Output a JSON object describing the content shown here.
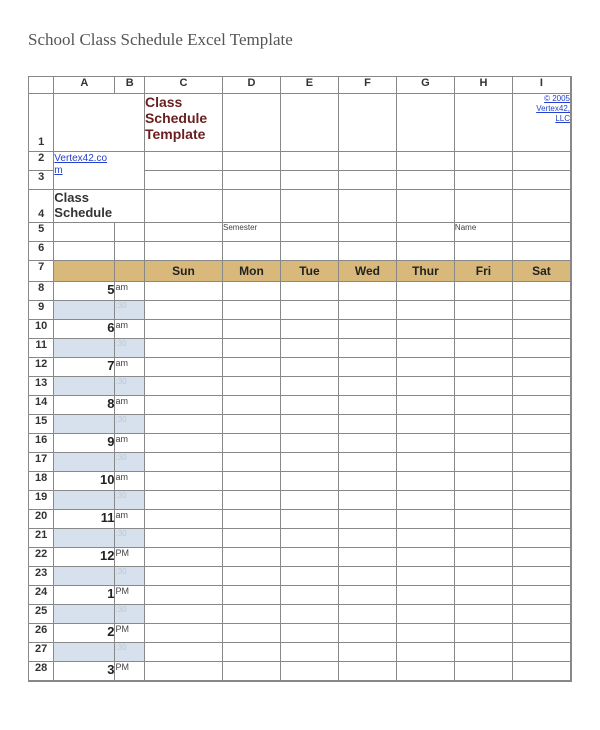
{
  "title": "School Class Schedule Excel Template",
  "columns": [
    "A",
    "B",
    "C",
    "D",
    "E",
    "F",
    "G",
    "H",
    "I"
  ],
  "header": {
    "headline_line1": "Class",
    "headline_line2": "Schedule",
    "headline_line3": "Template",
    "copyright_line1": "© 2005",
    "copyright_line2": "Vertex42,",
    "copyright_line3": "LLC",
    "vertex_link_1": "Vertex42.co",
    "vertex_link_2": "m"
  },
  "rows_1to6": {
    "row4_label": "Class Schedule",
    "row5_semester": "Semester",
    "row5_name": "Name"
  },
  "days": [
    "Sun",
    "Mon",
    "Tue",
    "Wed",
    "Thur",
    "Fri",
    "Sat"
  ],
  "time_rows": [
    {
      "row": 8,
      "hour": "5",
      "ampm": "am"
    },
    {
      "row": 9,
      "hour": "",
      "ampm": ":30",
      "sub": true
    },
    {
      "row": 10,
      "hour": "6",
      "ampm": "am"
    },
    {
      "row": 11,
      "hour": "",
      "ampm": ":30",
      "sub": true
    },
    {
      "row": 12,
      "hour": "7",
      "ampm": "am"
    },
    {
      "row": 13,
      "hour": "",
      "ampm": ":30",
      "sub": true
    },
    {
      "row": 14,
      "hour": "8",
      "ampm": "am"
    },
    {
      "row": 15,
      "hour": "",
      "ampm": ":30",
      "sub": true
    },
    {
      "row": 16,
      "hour": "9",
      "ampm": "am"
    },
    {
      "row": 17,
      "hour": "",
      "ampm": ":30",
      "sub": true
    },
    {
      "row": 18,
      "hour": "10",
      "ampm": "am"
    },
    {
      "row": 19,
      "hour": "",
      "ampm": ":30",
      "sub": true
    },
    {
      "row": 20,
      "hour": "11",
      "ampm": "am"
    },
    {
      "row": 21,
      "hour": "",
      "ampm": ":30",
      "sub": true
    },
    {
      "row": 22,
      "hour": "12",
      "ampm": "PM"
    },
    {
      "row": 23,
      "hour": "",
      "ampm": ":30",
      "sub": true
    },
    {
      "row": 24,
      "hour": "1",
      "ampm": "PM"
    },
    {
      "row": 25,
      "hour": "",
      "ampm": ":30",
      "sub": true
    },
    {
      "row": 26,
      "hour": "2",
      "ampm": "PM"
    },
    {
      "row": 27,
      "hour": "",
      "ampm": ":30",
      "sub": true
    },
    {
      "row": 28,
      "hour": "3",
      "ampm": "PM"
    }
  ]
}
